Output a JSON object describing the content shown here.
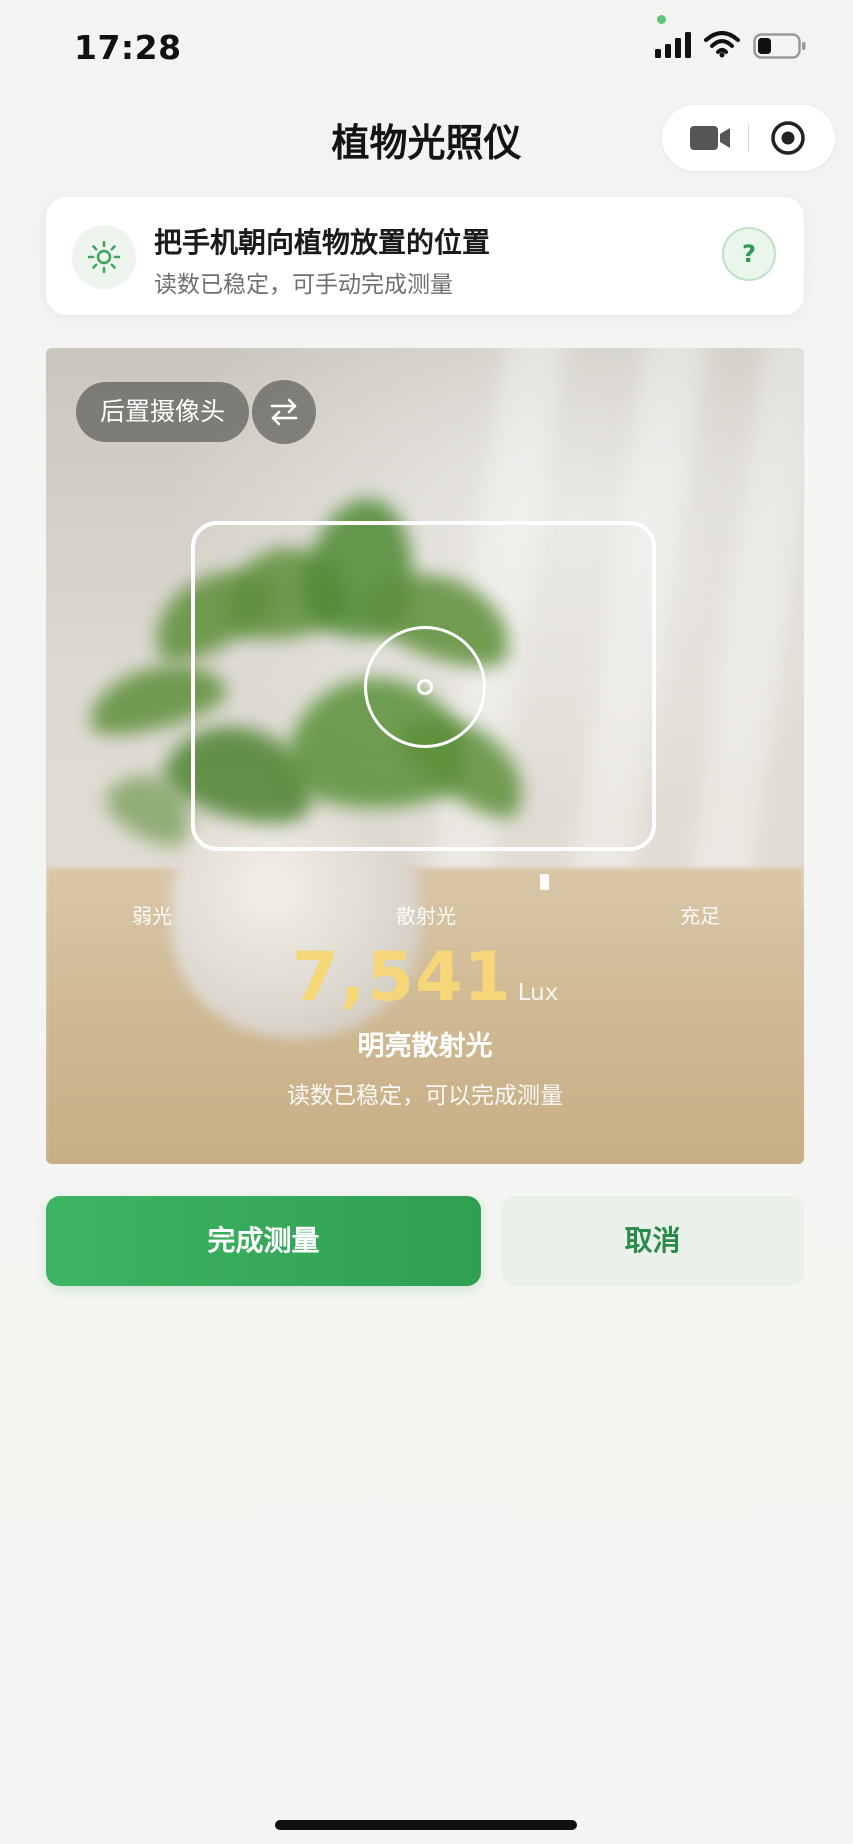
{
  "status_bar": {
    "time": "17:28",
    "icons": [
      "signal-icon",
      "wifi-icon",
      "battery-icon"
    ]
  },
  "header": {
    "title": "植物光照仪",
    "capsule_icons": [
      "video-camera-icon",
      "target-icon"
    ]
  },
  "tip": {
    "icon": "sun-icon",
    "title": "把手机朝向植物放置的位置",
    "subtitle": "读数已稳定，可手动完成测量",
    "help_label": "?"
  },
  "camera": {
    "switch_label": "后置摄像头",
    "flip_icon": "swap-arrows-icon",
    "scale": {
      "low": "弱光",
      "mid": "散射光",
      "high": "充足",
      "level_fraction": 0.6
    },
    "lux_value": "7,541",
    "lux_unit": "Lux",
    "level_label": "明亮散射光",
    "stable_hint": "读数已稳定，可以完成测量"
  },
  "actions": {
    "finish_label": "完成测量",
    "cancel_label": "取消"
  },
  "colors": {
    "primary_green": "#34a85a",
    "lux_yellow": "#f5d77a"
  }
}
